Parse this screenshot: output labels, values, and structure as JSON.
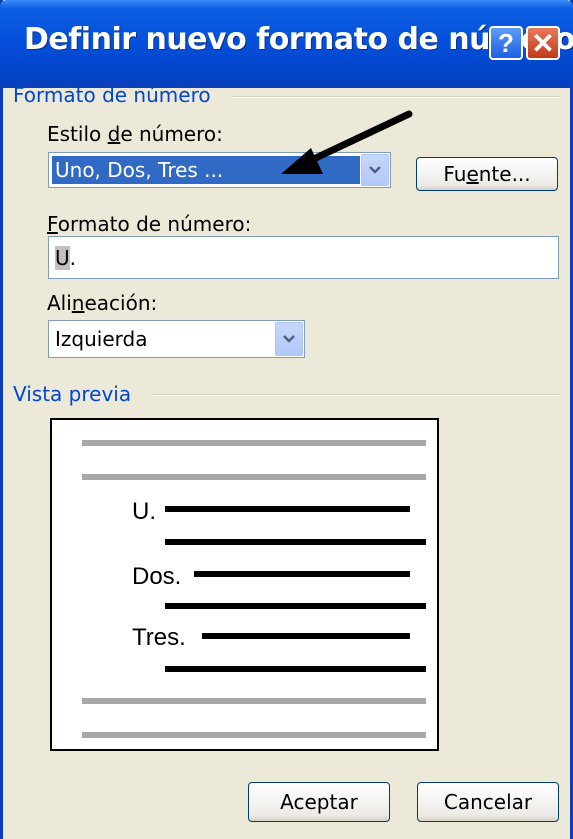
{
  "window": {
    "title": "Definir nuevo formato de número",
    "help_icon": "?",
    "close_icon": "✕"
  },
  "number_format_group": {
    "label": "Formato de número",
    "style_label_pre": "Estilo ",
    "style_label_key": "d",
    "style_label_post": "e número:",
    "style_value": "Uno, Dos, Tres ...",
    "font_button_pre": "Fu",
    "font_button_key": "e",
    "font_button_post": "nte...",
    "format_label_pre": "",
    "format_label_key": "F",
    "format_label_post": "ormato de número:",
    "format_value_highlight": "U",
    "format_value_rest": ".",
    "alignment_label_pre": "Ali",
    "alignment_label_key": "n",
    "alignment_label_post": "eación:",
    "alignment_value": "Izquierda"
  },
  "preview_group": {
    "label": "Vista previa",
    "items": [
      "U.",
      "Dos.",
      "Tres."
    ]
  },
  "buttons": {
    "ok": "Aceptar",
    "cancel": "Cancelar"
  },
  "colors": {
    "title_bar": "#0550dc",
    "group_label": "#0046d5",
    "selection": "#316ac5",
    "preview_gray_line": "#a8a8a8"
  },
  "icons": {
    "help": "question-mark-icon",
    "close": "close-x-icon",
    "dropdown": "chevron-down-icon",
    "annotation": "arrow-annotation"
  }
}
